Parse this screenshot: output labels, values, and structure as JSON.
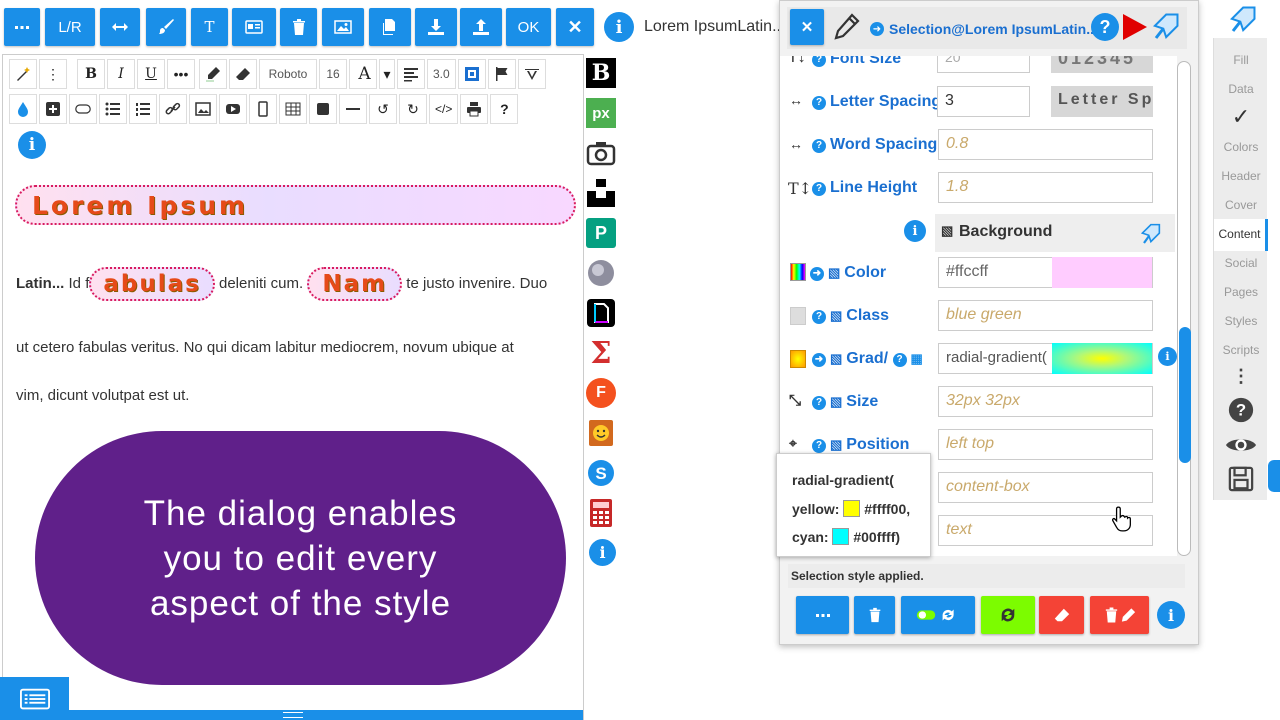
{
  "toolbar": {
    "buttons": [
      "more",
      "L/R",
      "resize",
      "brush",
      "T",
      "card",
      "delete",
      "image",
      "copy",
      "download",
      "upload",
      "OK",
      "close"
    ],
    "lr_label": "L/R",
    "t_label": "T",
    "ok_label": "OK",
    "doc_title": "Lorem IpsumLatin..."
  },
  "editor_toolbar": {
    "bold": "B",
    "italic": "I",
    "underline": "U",
    "font": "Roboto",
    "font_size": "16",
    "letter_a": "A",
    "line_height": "3.0",
    "help": "?"
  },
  "content": {
    "heading": "Lorem Ipsum",
    "p1_bold": "Latin...",
    "p1_a": " Id f",
    "pill1": "abulas",
    "p1_b": " deleniti cum. ",
    "pill2": "Nam",
    "p1_c": " te justo invenire. Duo",
    "p2": "ut cetero fabulas veritus. No qui dicam labitur mediocrem, novum ubique at",
    "p3": "vim, dicunt volutpat est ut.",
    "oval_lines": [
      "The dialog enables",
      "you to edit every",
      "aspect of the style"
    ]
  },
  "app_icons": {
    "b": "B",
    "px": "px",
    "f": "F",
    "sigma": "Σ"
  },
  "dialog": {
    "title": "Selection@Lorem IpsumLatin.....",
    "rows": {
      "font_size_label": "Font Size",
      "font_size_value": "20",
      "font_size_preview": "012345",
      "letter_spacing_label": "Letter Spacing",
      "letter_spacing_value": "3",
      "letter_spacing_preview": "Letter Spa",
      "word_spacing_label": "Word Spacing",
      "word_spacing_value": "0.8",
      "line_height_label": "Line Height",
      "line_height_value": "1.8",
      "background_section": "Background",
      "color_label": "Color",
      "color_value": "#ffccff",
      "class_label": "Class",
      "class_value": "blue green",
      "grad_label": "Grad/",
      "grad_value": "radial-gradient(",
      "size_label": "Size",
      "size_value": "32px 32px",
      "position_label": "Position",
      "position_value": "left top",
      "origin_value": "content-box",
      "clip_value": "text"
    },
    "status": "Selection style applied.",
    "tooltip": {
      "line1": "radial-gradient(",
      "yellow_label": "yellow:",
      "yellow_hex": "#ffff00,",
      "cyan_label": "cyan:",
      "cyan_hex": "#00ffff)"
    }
  },
  "sidebar": {
    "items": [
      "Fill",
      "Data",
      "Colors",
      "Header",
      "Cover",
      "Content",
      "Social",
      "Pages",
      "Styles",
      "Scripts"
    ],
    "active": "Content"
  },
  "colors": {
    "accent": "#1a8fe8",
    "oval": "#60208a",
    "pill_text": "#e64a19",
    "swatch_color": "#ffccff",
    "green_button": "#7cfc00",
    "red_button": "#f44336"
  }
}
